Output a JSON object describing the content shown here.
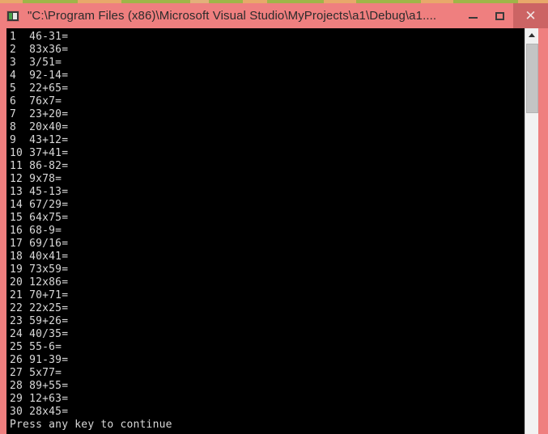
{
  "window": {
    "title": "\"C:\\Program Files (x86)\\Microsoft Visual Studio\\MyProjects\\a1\\Debug\\a1....",
    "icon": "console-app-icon",
    "controls": {
      "minimize_label": "",
      "maximize_label": "",
      "close_label": "✕"
    },
    "colors": {
      "titlebar": "#ef7f7f",
      "border": "#ef7f7f",
      "close_button": "#cc6464",
      "console_background": "#000000",
      "console_text": "#d9d9d9",
      "scrollbar_track": "#f2f2f2",
      "scrollbar_thumb": "#c4c4c4"
    }
  },
  "console": {
    "lines": [
      "1  46-31=",
      "2  83x36=",
      "3  3/51=",
      "4  92-14=",
      "5  22+65=",
      "6  76x7=",
      "7  23+20=",
      "8  20x40=",
      "9  43+12=",
      "10 37+41=",
      "11 86-82=",
      "12 9x78=",
      "13 45-13=",
      "14 67/29=",
      "15 64x75=",
      "16 68-9=",
      "17 69/16=",
      "18 40x41=",
      "19 73x59=",
      "20 12x86=",
      "21 70+71=",
      "22 22x25=",
      "23 59+26=",
      "24 40/35=",
      "25 55-6=",
      "26 91-39=",
      "27 5x77=",
      "28 89+55=",
      "29 12+63=",
      "30 28x45=",
      "Press any key to continue"
    ],
    "text": "1  46-31=\n2  83x36=\n3  3/51=\n4  92-14=\n5  22+65=\n6  76x7=\n7  23+20=\n8  20x40=\n9  43+12=\n10 37+41=\n11 86-82=\n12 9x78=\n13 45-13=\n14 67/29=\n15 64x75=\n16 68-9=\n17 69/16=\n18 40x41=\n19 73x59=\n20 12x86=\n21 70+71=\n22 22x25=\n23 59+26=\n24 40/35=\n25 55-6=\n26 91-39=\n27 5x77=\n28 89+55=\n29 12+63=\n30 28x45=\nPress any key to continue"
  },
  "scrollbar": {
    "up_arrow": "scroll-up-arrow",
    "position": "top"
  }
}
